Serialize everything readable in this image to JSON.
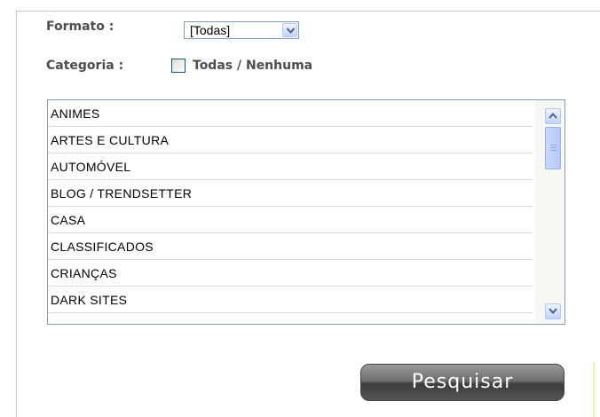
{
  "form": {
    "format_label": "Formato :",
    "format_select_value": "[Todas]",
    "category_label": "Categoria :",
    "category_toggle_text": "Todas / Nenhuma",
    "categories": [
      "ANIMES",
      "ARTES E CULTURA",
      "AUTOMÓVEL",
      "BLOG / TRENDSETTER",
      "CASA",
      "CLASSIFICADOS",
      "CRIANÇAS",
      "DARK SITES"
    ],
    "search_button_label": "Pesquisar"
  },
  "colors": {
    "label_text": "#4d4d4d",
    "list_border": "#7f9db9",
    "button_dark": "#3c3c3c"
  },
  "icons": {
    "select_arrow": "chevron-down-icon",
    "scroll_up": "chevron-up-icon",
    "scroll_down": "chevron-down-icon"
  }
}
